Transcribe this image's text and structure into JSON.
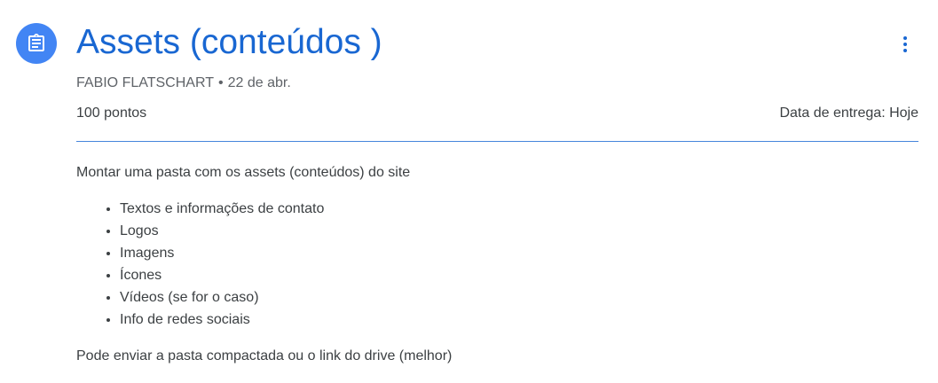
{
  "assignment": {
    "title": "Assets (conteúdos )",
    "author": "FABIO FLATSCHART",
    "separator": "•",
    "date": "22 de abr.",
    "points": "100 pontos",
    "due": "Data de entrega: Hoje"
  },
  "description": {
    "intro": "Montar uma pasta com os assets (conteúdos) do site",
    "items": [
      "Textos e informações de contato",
      "Logos",
      "Imagens",
      "Ícones",
      "Vídeos (se for o caso)",
      "Info de redes sociais"
    ],
    "outro": "Pode enviar a pasta compactada ou o link do drive (melhor)"
  },
  "icons": {
    "assignment": "assignment-icon",
    "more": "more-vert-icon"
  },
  "colors": {
    "accent": "#1967d2",
    "icon_bg": "#4285f4"
  }
}
